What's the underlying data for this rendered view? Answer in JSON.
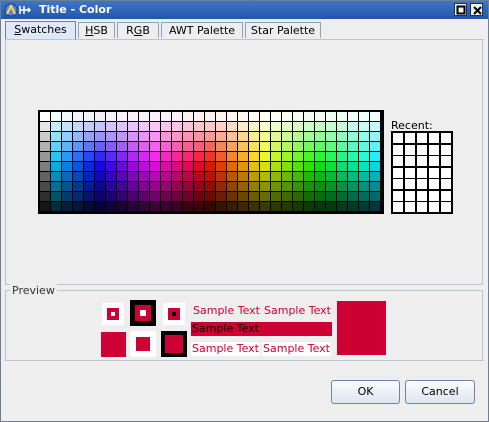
{
  "window": {
    "title": "Title - Color"
  },
  "tabs": [
    {
      "label": "Swatches",
      "mnemonic_index": 0,
      "active": true
    },
    {
      "label": "HSB",
      "mnemonic_index": 0,
      "active": false
    },
    {
      "label": "RGB",
      "mnemonic_index": 1,
      "active": false
    },
    {
      "label": "AWT Palette",
      "mnemonic_index": -1,
      "active": false
    },
    {
      "label": "Star Palette",
      "mnemonic_index": -1,
      "active": false
    }
  ],
  "swatches": {
    "rows": 10,
    "cols": 31
  },
  "recent": {
    "label": "Recent:",
    "rows": 7,
    "cols": 5
  },
  "preview": {
    "label": "Preview",
    "sample_text": "Sample Text",
    "color": "#cc0033"
  },
  "buttons": {
    "ok": "OK",
    "cancel": "Cancel"
  }
}
